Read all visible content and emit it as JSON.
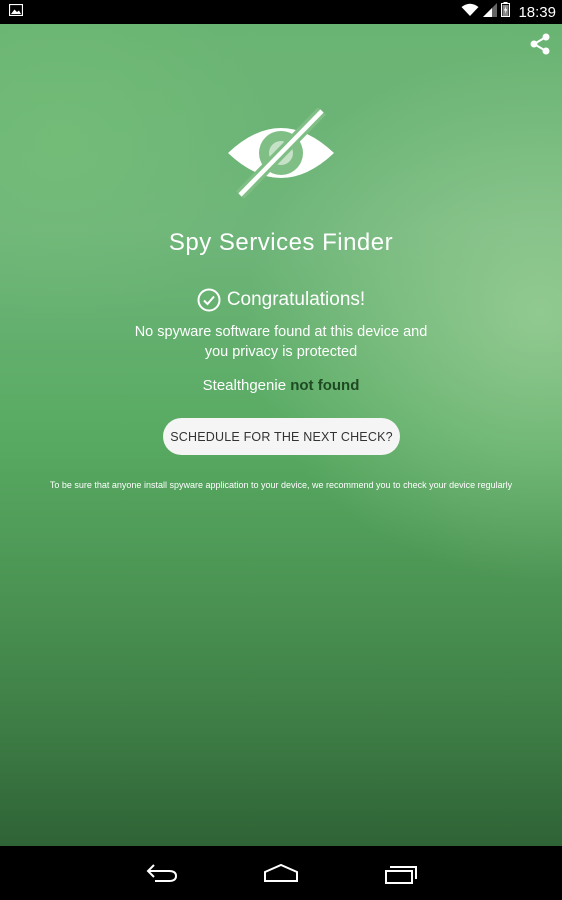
{
  "status_bar": {
    "time": "18:39",
    "icons": [
      "image-notification-icon",
      "wifi-icon",
      "signal-icon",
      "battery-icon"
    ]
  },
  "app": {
    "title": "Spy Services Finder",
    "hero_icon": "eye-slash-icon",
    "congrats_icon": "check-circle-icon",
    "congrats_text": "Congratulations!",
    "message": "No spyware software found at this device and you privacy is protected",
    "result": {
      "app_name": "Stealthgenie",
      "status": "not found"
    },
    "schedule_button_label": "SCHEDULE FOR THE NEXT CHECK?",
    "footnote": "To be sure that anyone install spyware application to your device, we recommend you to check your device regularly",
    "share_icon": "share-icon"
  },
  "nav_bar": {
    "buttons": [
      "back-icon",
      "home-icon",
      "recent-apps-icon"
    ]
  },
  "colors": {
    "accent_dark_green": "#1e4a23",
    "background_green": "#5fae68",
    "button_bg": "#f5f5f5"
  }
}
